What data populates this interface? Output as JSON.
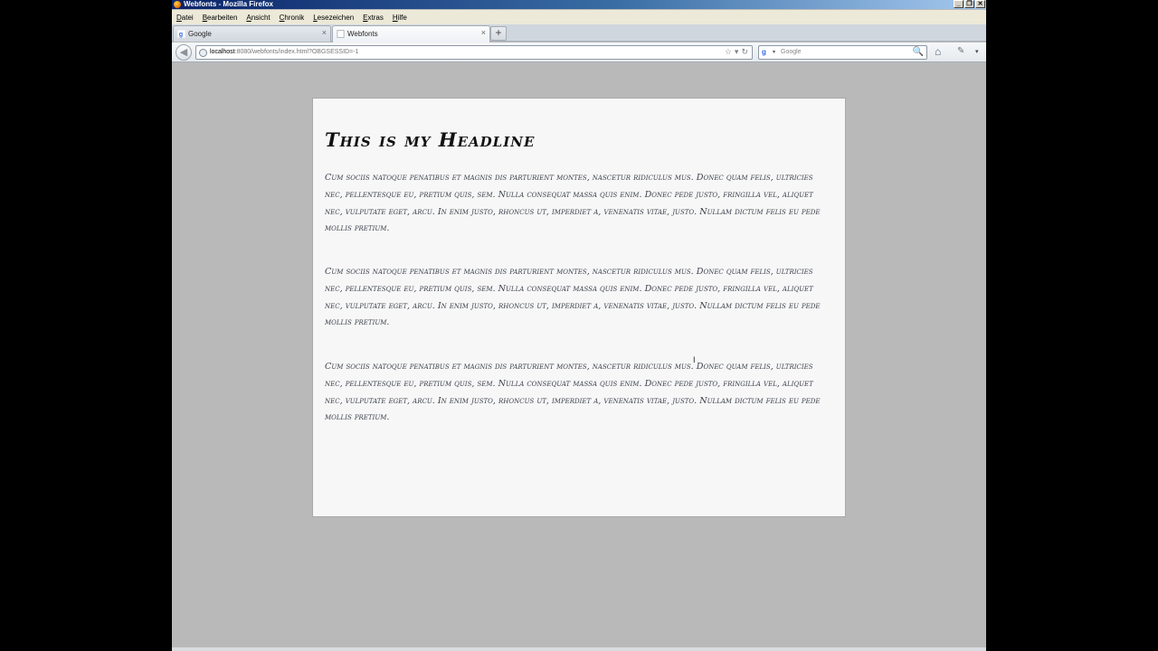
{
  "window": {
    "title": "Webfonts - Mozilla Firefox",
    "controls": [
      "_",
      "❐",
      "✕"
    ]
  },
  "menubar": {
    "items": [
      "Datei",
      "Bearbeiten",
      "Ansicht",
      "Chronik",
      "Lesezeichen",
      "Extras",
      "Hilfe"
    ]
  },
  "tabs": [
    {
      "label": "Google",
      "close": "×"
    },
    {
      "label": "Webfonts",
      "close": "×",
      "active": true
    }
  ],
  "newtab": {
    "label": "+"
  },
  "navbar": {
    "back": "◀",
    "url_host": "localhost",
    "url_rest": ":8080/webfonts/index.html?OBGSESSID=-1",
    "url_icons": [
      "☆",
      "▾",
      "↻"
    ],
    "search_engine": "g",
    "search_placeholder": "Google",
    "search_icon": "🔍",
    "home": "⌂",
    "addon": "✎",
    "menu_arrow": "▾"
  },
  "page": {
    "headline": "This is my Headline",
    "paragraphs": [
      "Cum sociis natoque penatibus et magnis dis parturient montes, nascetur ridiculus mus. Donec quam felis, ultricies nec, pellentesque eu, pretium quis, sem. Nulla consequat massa quis enim. Donec pede justo, fringilla vel, aliquet nec, vulputate eget, arcu. In enim justo, rhoncus ut, imperdiet a, venenatis vitae, justo. Nullam dictum felis eu pede mollis pretium.",
      "Cum sociis natoque penatibus et magnis dis parturient montes, nascetur ridiculus mus. Donec quam felis, ultricies nec, pellentesque eu, pretium quis, sem. Nulla consequat massa quis enim. Donec pede justo, fringilla vel, aliquet nec, vulputate eget, arcu. In enim justo, rhoncus ut, imperdiet a, venenatis vitae, justo. Nullam dictum felis eu pede mollis pretium.",
      "Cum sociis natoque penatibus et magnis dis parturient montes, nascetur ridiculus mus. Donec quam felis, ultricies nec, pellentesque eu, pretium quis, sem. Nulla consequat massa quis enim. Donec pede justo, fringilla vel, aliquet nec, vulputate eget, arcu. In enim justo, rhoncus ut, imperdiet a, venenatis vitae, justo. Nullam dictum felis eu pede mollis pretium."
    ]
  },
  "cursor": "I"
}
